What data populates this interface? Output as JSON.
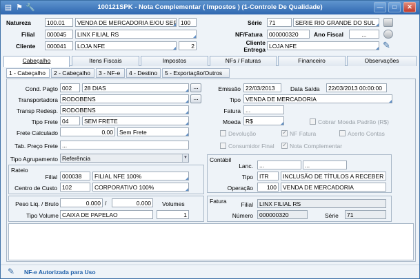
{
  "window": {
    "title": "100121SPK - Nota Complementar ( Impostos ) (1-Controle De Qualidade)"
  },
  "header": {
    "natureza": {
      "label": "Natureza",
      "code": "100.01",
      "desc": "VENDA DE MERCADORIA E/OU SERVI",
      "extra": "100"
    },
    "filial": {
      "label": "Filial",
      "code": "000045",
      "desc": "LINX FILIAL RS"
    },
    "cliente": {
      "label": "Cliente",
      "code": "000041",
      "desc": "LOJA NFE",
      "extra": "2"
    },
    "serie": {
      "label": "Série",
      "code": "71",
      "desc": "SERIE RIO GRANDE DO SUL"
    },
    "nf_fatura": {
      "label": "NF/Fatura",
      "value": "000000320"
    },
    "ano_fiscal": {
      "label": "Ano Fiscal",
      "value": "..."
    },
    "cliente_entrega": {
      "label_1": "Cliente",
      "label_2": "Entrega",
      "value": "LOJA NFE"
    }
  },
  "tabs": [
    "Cabeçalho",
    "Itens Fiscais",
    "Impostos",
    "NFs / Faturas",
    "Financeiro",
    "Observações"
  ],
  "subtabs": [
    "1 - Cabeçalho",
    "2 - Cabeçalho",
    "3 - NF-e",
    "4 - Destino",
    "5 - Exportação/Outros"
  ],
  "form": {
    "cond_pagto": {
      "label": "Cond. Pagto",
      "code": "002",
      "desc": "28 DIAS"
    },
    "transportadora": {
      "label": "Transportadora",
      "value": "RODOBENS"
    },
    "transp_redesp": {
      "label": "Transp Redesp.",
      "value": "RODOBENS"
    },
    "tipo_frete": {
      "label": "Tipo Frete",
      "code": "04",
      "desc": "SEM FRETE"
    },
    "frete_calculado": {
      "label": "Frete Calculado",
      "value": "0.00",
      "desc": "Sem Frete"
    },
    "tab_preco_frete": {
      "label": "Tab. Preço Frete",
      "value": "..."
    },
    "tipo_agrupamento": {
      "label": "Tipo Agrupamento",
      "value": "Referência"
    },
    "emissao": {
      "label": "Emissão",
      "value": "22/03/2013"
    },
    "data_saida": {
      "label": "Data Saída",
      "value": "22/03/2013 00:00:00"
    },
    "tipo": {
      "label": "Tipo",
      "value": "VENDA DE MERCADORIA"
    },
    "fatura": {
      "label": "Fatura",
      "value": "..."
    },
    "moeda": {
      "label": "Moeda",
      "value": "R$"
    },
    "cobrar_moeda": "Cobrar Moeda Padrão (R$)",
    "devolucao": "Devolução",
    "nf_fatura_chk": "NF Fatura",
    "acerto_contas": "Acerto Contas",
    "consumidor_final": "Consumidor Final",
    "nota_complementar": "Nota Complementar"
  },
  "rateio": {
    "title": "Rateio",
    "filial": {
      "label": "Filial",
      "code": "000038",
      "desc": "FILIAL NFE 100%"
    },
    "centro_custo": {
      "label": "Centro de Custo",
      "code": "102",
      "desc": "CORPORATIVO 100%"
    }
  },
  "contabil": {
    "title": "Contábil",
    "lanc": {
      "label": "Lanc.",
      "v1": "...",
      "v2": "..."
    },
    "tipo": {
      "label": "Tipo",
      "code": "ITR",
      "desc": "INCLUSÃO DE TÍTULOS A RECEBER"
    },
    "operacao": {
      "label": "Operação",
      "code": "100",
      "desc": "VENDA DE MERCADORIA"
    }
  },
  "volumes": {
    "peso_label": "Peso Liq. / Bruto",
    "peso_liq": "0.000",
    "slash": "/",
    "peso_bruto": "0.000",
    "volumes_label": "Volumes",
    "tipo_volume_label": "Tipo Volume",
    "tipo_volume": "CAIXA DE PAPELAO",
    "qtd": "1"
  },
  "fatura_box": {
    "title": "Fatura",
    "filial_label": "Filial",
    "filial": "LINX FILIAL RS",
    "numero_label": "Número",
    "numero": "000000320",
    "serie_label": "Série",
    "serie": "71"
  },
  "status": {
    "text": "NF-e Autorizada para Uso"
  },
  "colors": {
    "title": "#2f67b0",
    "status_text": "#1f5fa8",
    "panel": "#eef3f8"
  }
}
